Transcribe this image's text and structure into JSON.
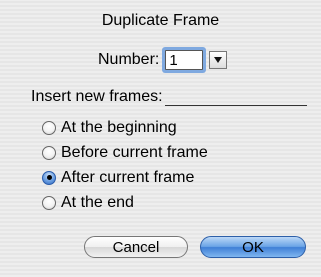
{
  "dialog": {
    "title": "Duplicate Frame",
    "number_label": "Number:",
    "number_value": "1",
    "insert_label": "Insert new frames:",
    "options": [
      {
        "label": "At the beginning",
        "selected": false
      },
      {
        "label": "Before current frame",
        "selected": false
      },
      {
        "label": "After current frame",
        "selected": true
      },
      {
        "label": "At the end",
        "selected": false
      }
    ],
    "cancel_label": "Cancel",
    "ok_label": "OK"
  },
  "icons": {
    "dropdown": "triangle-down-icon"
  },
  "colors": {
    "accent": "#3f7fd6",
    "focus_ring": "#7fa9e0"
  }
}
